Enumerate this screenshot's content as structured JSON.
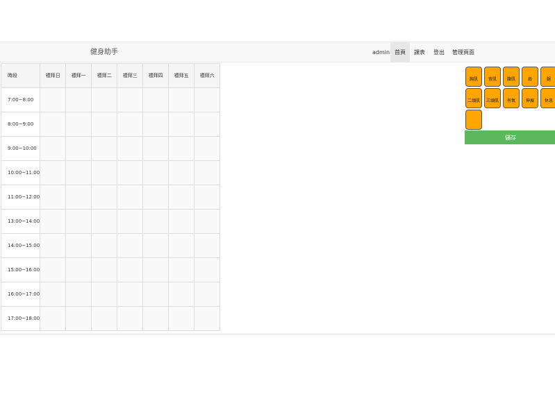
{
  "nav": {
    "brand": "健身助手",
    "user": "admin",
    "links": [
      "首頁",
      "課表",
      "登出",
      "管理頁面"
    ]
  },
  "schedule": {
    "headers": [
      "時段",
      "禮拜日",
      "禮拜一",
      "禮拜二",
      "禮拜三",
      "禮拜四",
      "禮拜五",
      "禮拜六"
    ],
    "times": [
      "7:00~8:00",
      "8:00~9:00",
      "9:00~10:00",
      "10:00~11:00",
      "11:00~12:00",
      "13:00~14:00",
      "14:00~15:00",
      "15:00~16:00",
      "16:00~17:00",
      "17:00~18:00"
    ]
  },
  "palette": {
    "items": [
      "胸肌",
      "背肌",
      "腹肌",
      "肩",
      "腿",
      "二頭肌",
      "三頭肌",
      "有氧",
      "伸展",
      "休息",
      ""
    ],
    "tile_color": "#ffa500"
  },
  "save": {
    "label": "儲存",
    "color": "#5cb85c"
  }
}
